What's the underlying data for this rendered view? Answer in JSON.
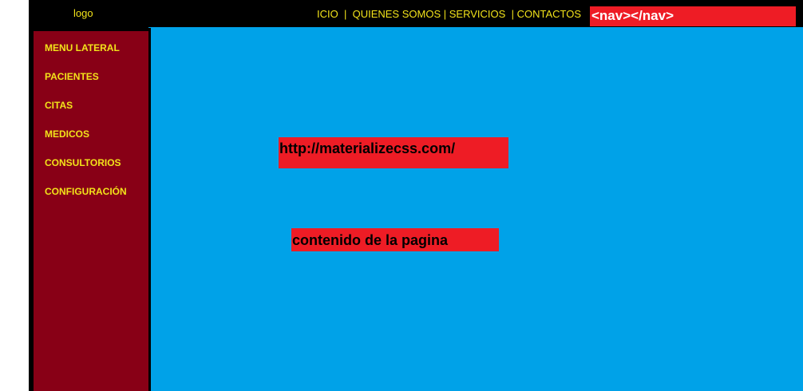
{
  "header": {
    "logo": "logo",
    "nav_items": [
      {
        "label": "ICIO"
      },
      {
        "label": "QUIENES SOMOS"
      },
      {
        "label": "SERVICIOS"
      },
      {
        "label": "CONTACTOS"
      }
    ],
    "separator": "|",
    "nav_tag": "<nav></nav>"
  },
  "sidebar": {
    "items": [
      {
        "label": "MENU LATERAL"
      },
      {
        "label": "PACIENTES"
      },
      {
        "label": "CITAS"
      },
      {
        "label": "MEDICOS"
      },
      {
        "label": "CONSULTORIOS"
      },
      {
        "label": "CONFIGURACIÓN"
      }
    ]
  },
  "main": {
    "url_label": "http://materializecss.com/",
    "content_label": "contenido de  la pagina"
  },
  "colors": {
    "frame": "#000000",
    "topbar_text": "#f2e31a",
    "sidebar_bg": "#880016",
    "sidebar_text": "#f2e31a",
    "main_bg": "#00a2e8",
    "label_bg": "#ee1c25",
    "nav_tag_text": "#ffffff"
  }
}
